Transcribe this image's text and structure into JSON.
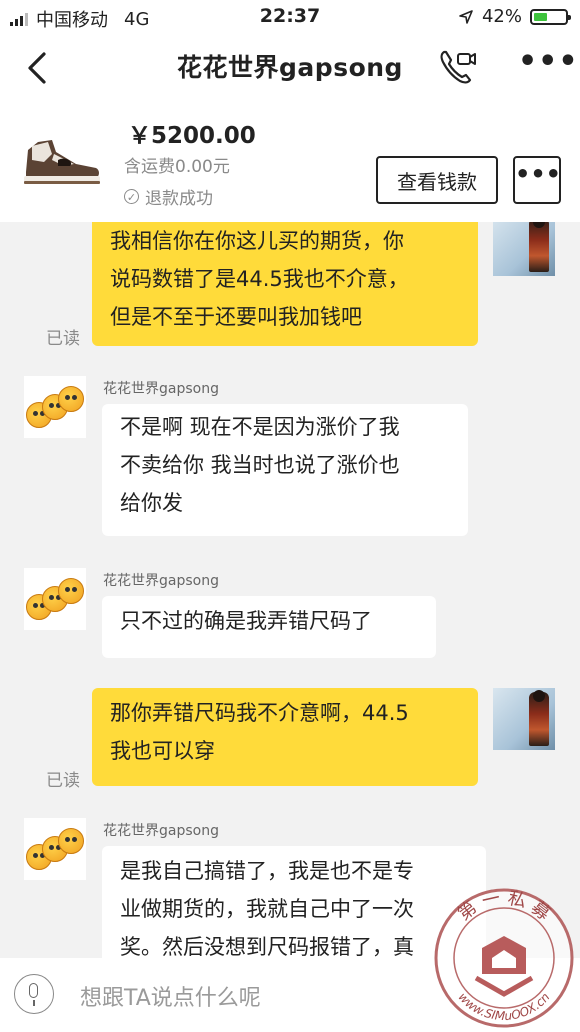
{
  "status_bar": {
    "carrier": "中国移动",
    "network": "4G",
    "time": "22:37",
    "battery": "42%",
    "battery_level": 0.42
  },
  "header": {
    "back_icon": "chevron-left-icon",
    "title": "花花世界gapsong",
    "call_icon": "video-call-icon",
    "more_label": "•••"
  },
  "product": {
    "price": "￥5200.00",
    "shipping": "含运费0.00元",
    "status": "退款成功",
    "view_button": "查看钱款",
    "more_button": "•••"
  },
  "messages": [
    {
      "from": "me",
      "read": "已读",
      "lines": [
        "我相信你在你这儿买的期货，你",
        "说码数错了是44.5我也不介意，",
        "但是不至于还要叫我加钱吧"
      ]
    },
    {
      "from": "them",
      "sender": "花花世界gapsong",
      "lines": [
        "不是啊 现在不是因为涨价了我",
        "不卖给你 我当时也说了涨价也",
        "给你发"
      ]
    },
    {
      "from": "them",
      "sender": "花花世界gapsong",
      "lines": [
        "只不过的确是我弄错尺码了"
      ]
    },
    {
      "from": "me",
      "read": "已读",
      "lines": [
        "那你弄错尺码我不介意啊，44.5",
        "我也可以穿"
      ]
    },
    {
      "from": "them",
      "sender": "花花世界gapsong",
      "lines": [
        "是我自己搞错了，我是也不是专",
        "业做期货的，我就自己中了一次",
        "奖。然后没想到尺码报错了，真"
      ]
    }
  ],
  "input": {
    "placeholder": "想跟TA说点什么呢"
  },
  "watermark": {
    "text_top": "第 一 私 募",
    "text_bottom": "www.SIMuOOX.cn"
  }
}
